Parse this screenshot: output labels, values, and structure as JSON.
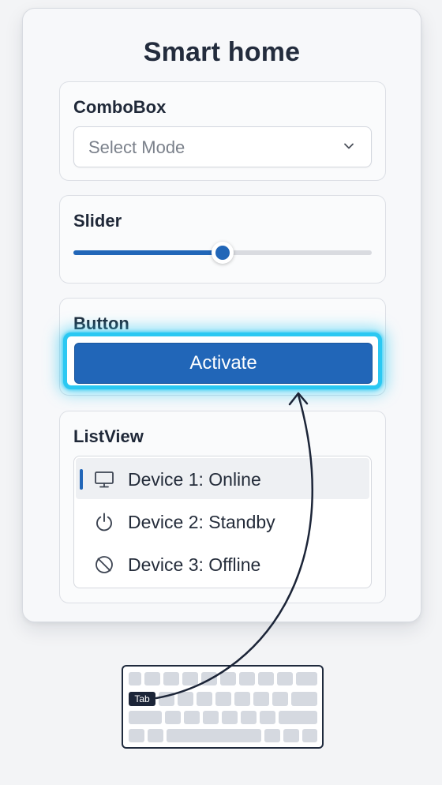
{
  "app": {
    "title": "Smart home"
  },
  "combobox": {
    "label": "ComboBox",
    "placeholder": "Select Mode"
  },
  "slider": {
    "label": "Slider",
    "value_fraction": 0.5
  },
  "button_section": {
    "label": "Button",
    "button_label": "Activate",
    "focused": true
  },
  "listview": {
    "label": "ListView",
    "items": [
      {
        "label": "Device 1: Online",
        "icon": "monitor-icon",
        "selected": true
      },
      {
        "label": "Device 2: Standby",
        "icon": "power-icon",
        "selected": false
      },
      {
        "label": "Device 3: Offline",
        "icon": "offline-icon",
        "selected": false
      }
    ]
  },
  "keyboard": {
    "highlighted_key": "Tab"
  },
  "colors": {
    "accent": "#2166b8",
    "focus_ring": "#2bc8f2",
    "title": "#232c3d",
    "key": "#d5d9e0"
  }
}
